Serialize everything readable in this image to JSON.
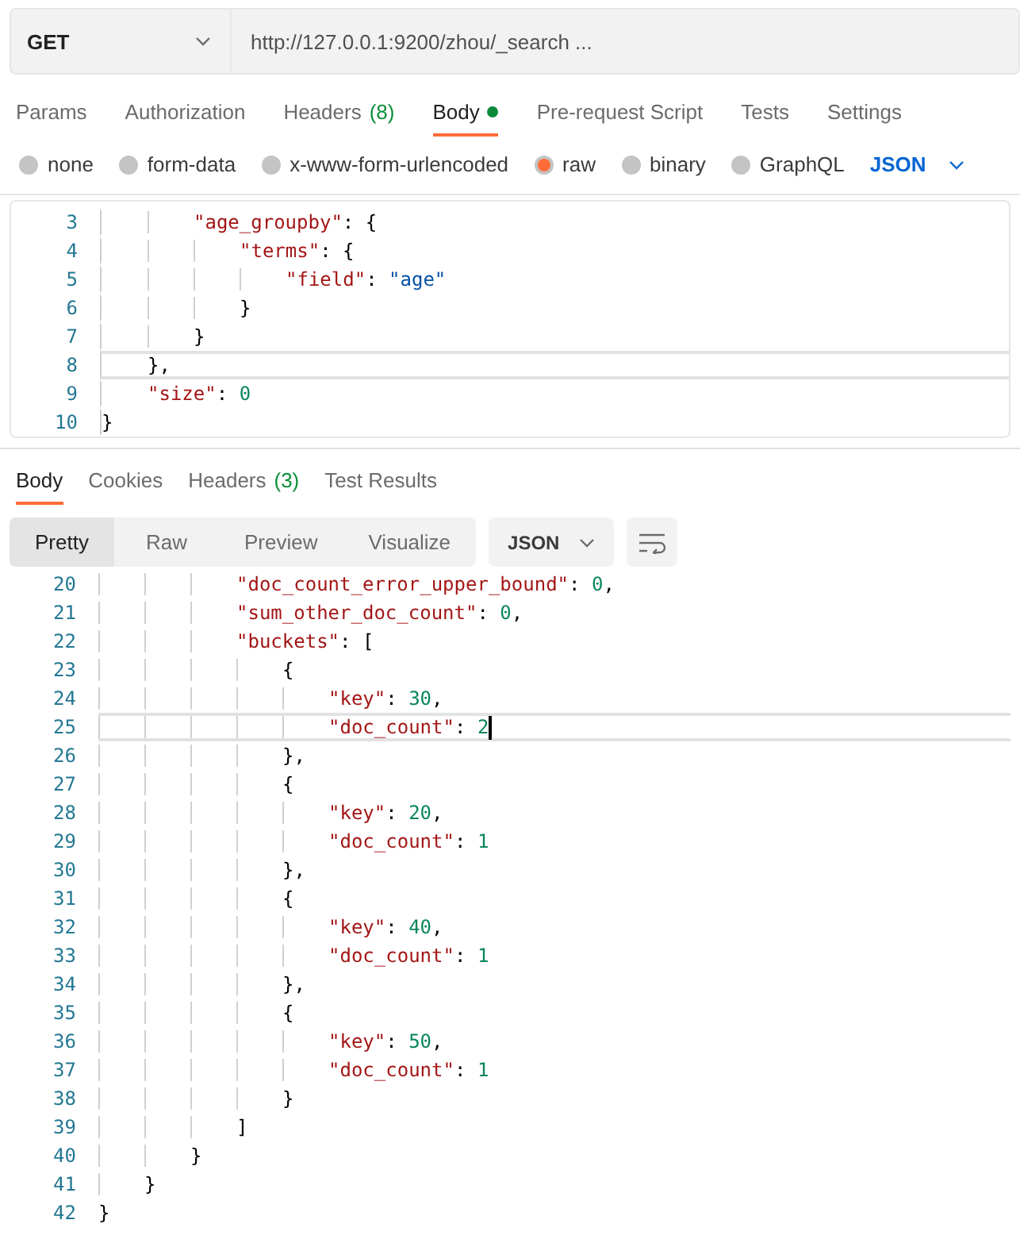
{
  "request": {
    "method": "GET",
    "url": "http://127.0.0.1:9200/zhou/_search ..."
  },
  "request_tabs": [
    {
      "label": "Params",
      "selected": false,
      "dot": false
    },
    {
      "label": "Authorization",
      "selected": false,
      "dot": false
    },
    {
      "label": "Headers",
      "count": "(8)",
      "selected": false,
      "dot": false
    },
    {
      "label": "Body",
      "dot": true,
      "selected": true
    },
    {
      "label": "Pre-request Script",
      "selected": false,
      "dot": false
    },
    {
      "label": "Tests",
      "selected": false,
      "dot": false
    },
    {
      "label": "Settings",
      "selected": false,
      "dot": false
    }
  ],
  "body_types": [
    {
      "label": "none",
      "selected": false
    },
    {
      "label": "form-data",
      "selected": false
    },
    {
      "label": "x-www-form-urlencoded",
      "selected": false
    },
    {
      "label": "raw",
      "selected": true
    },
    {
      "label": "binary",
      "selected": false
    },
    {
      "label": "GraphQL",
      "selected": false
    }
  ],
  "body_format": "JSON",
  "request_editor": [
    {
      "num": "3",
      "current": false,
      "tokens": [
        {
          "kind": "key",
          "text": "\t\t\"age_groupby\""
        },
        {
          "kind": "punct",
          "text": ": {"
        }
      ]
    },
    {
      "num": "4",
      "current": false,
      "tokens": [
        {
          "kind": "key",
          "text": "\t\t\t\"terms\""
        },
        {
          "kind": "punct",
          "text": ": {"
        }
      ]
    },
    {
      "num": "5",
      "current": false,
      "tokens": [
        {
          "kind": "key",
          "text": "\t\t\t\t\"field\""
        },
        {
          "kind": "punct",
          "text": ": "
        },
        {
          "kind": "str",
          "text": "\"age\""
        }
      ]
    },
    {
      "num": "6",
      "current": false,
      "tokens": [
        {
          "kind": "punct",
          "text": "\t\t\t}"
        }
      ]
    },
    {
      "num": "7",
      "current": false,
      "tokens": [
        {
          "kind": "punct",
          "text": "\t\t}"
        }
      ]
    },
    {
      "num": "8",
      "current": true,
      "tokens": [
        {
          "kind": "punct",
          "text": "\t},"
        }
      ]
    },
    {
      "num": "9",
      "current": false,
      "tokens": [
        {
          "kind": "key",
          "text": "\t\"size\""
        },
        {
          "kind": "punct",
          "text": ": "
        },
        {
          "kind": "num",
          "text": "0"
        }
      ]
    },
    {
      "num": "10",
      "current": false,
      "tokens": [
        {
          "kind": "punct",
          "text": "}"
        }
      ]
    }
  ],
  "response_tabs": [
    {
      "label": "Body",
      "selected": true
    },
    {
      "label": "Cookies",
      "selected": false
    },
    {
      "label": "Headers",
      "count": "(3)",
      "selected": false
    },
    {
      "label": "Test Results",
      "selected": false
    }
  ],
  "view_modes": [
    {
      "label": "Pretty",
      "selected": true
    },
    {
      "label": "Raw",
      "selected": false
    },
    {
      "label": "Preview",
      "selected": false
    },
    {
      "label": "Visualize",
      "selected": false
    }
  ],
  "response_format": "JSON",
  "response_editor": [
    {
      "num": "20",
      "current": false,
      "tokens": [
        {
          "kind": "key",
          "text": "\t\t\t\"doc_count_error_upper_bound\""
        },
        {
          "kind": "punct",
          "text": ": "
        },
        {
          "kind": "num",
          "text": "0"
        },
        {
          "kind": "punct",
          "text": ","
        }
      ]
    },
    {
      "num": "21",
      "current": false,
      "tokens": [
        {
          "kind": "key",
          "text": "\t\t\t\"sum_other_doc_count\""
        },
        {
          "kind": "punct",
          "text": ": "
        },
        {
          "kind": "num",
          "text": "0"
        },
        {
          "kind": "punct",
          "text": ","
        }
      ]
    },
    {
      "num": "22",
      "current": false,
      "tokens": [
        {
          "kind": "key",
          "text": "\t\t\t\"buckets\""
        },
        {
          "kind": "punct",
          "text": ": ["
        }
      ]
    },
    {
      "num": "23",
      "current": false,
      "tokens": [
        {
          "kind": "punct",
          "text": "\t\t\t\t{"
        }
      ]
    },
    {
      "num": "24",
      "current": false,
      "tokens": [
        {
          "kind": "key",
          "text": "\t\t\t\t\t\"key\""
        },
        {
          "kind": "punct",
          "text": ": "
        },
        {
          "kind": "num",
          "text": "30"
        },
        {
          "kind": "punct",
          "text": ","
        }
      ]
    },
    {
      "num": "25",
      "current": true,
      "tokens": [
        {
          "kind": "key",
          "text": "\t\t\t\t\t\"doc_count\""
        },
        {
          "kind": "punct",
          "text": ": "
        },
        {
          "kind": "num",
          "text": "2"
        }
      ]
    },
    {
      "num": "26",
      "current": false,
      "tokens": [
        {
          "kind": "punct",
          "text": "\t\t\t\t},"
        }
      ]
    },
    {
      "num": "27",
      "current": false,
      "tokens": [
        {
          "kind": "punct",
          "text": "\t\t\t\t{"
        }
      ]
    },
    {
      "num": "28",
      "current": false,
      "tokens": [
        {
          "kind": "key",
          "text": "\t\t\t\t\t\"key\""
        },
        {
          "kind": "punct",
          "text": ": "
        },
        {
          "kind": "num",
          "text": "20"
        },
        {
          "kind": "punct",
          "text": ","
        }
      ]
    },
    {
      "num": "29",
      "current": false,
      "tokens": [
        {
          "kind": "key",
          "text": "\t\t\t\t\t\"doc_count\""
        },
        {
          "kind": "punct",
          "text": ": "
        },
        {
          "kind": "num",
          "text": "1"
        }
      ]
    },
    {
      "num": "30",
      "current": false,
      "tokens": [
        {
          "kind": "punct",
          "text": "\t\t\t\t},"
        }
      ]
    },
    {
      "num": "31",
      "current": false,
      "tokens": [
        {
          "kind": "punct",
          "text": "\t\t\t\t{"
        }
      ]
    },
    {
      "num": "32",
      "current": false,
      "tokens": [
        {
          "kind": "key",
          "text": "\t\t\t\t\t\"key\""
        },
        {
          "kind": "punct",
          "text": ": "
        },
        {
          "kind": "num",
          "text": "40"
        },
        {
          "kind": "punct",
          "text": ","
        }
      ]
    },
    {
      "num": "33",
      "current": false,
      "tokens": [
        {
          "kind": "key",
          "text": "\t\t\t\t\t\"doc_count\""
        },
        {
          "kind": "punct",
          "text": ": "
        },
        {
          "kind": "num",
          "text": "1"
        }
      ]
    },
    {
      "num": "34",
      "current": false,
      "tokens": [
        {
          "kind": "punct",
          "text": "\t\t\t\t},"
        }
      ]
    },
    {
      "num": "35",
      "current": false,
      "tokens": [
        {
          "kind": "punct",
          "text": "\t\t\t\t{"
        }
      ]
    },
    {
      "num": "36",
      "current": false,
      "tokens": [
        {
          "kind": "key",
          "text": "\t\t\t\t\t\"key\""
        },
        {
          "kind": "punct",
          "text": ": "
        },
        {
          "kind": "num",
          "text": "50"
        },
        {
          "kind": "punct",
          "text": ","
        }
      ]
    },
    {
      "num": "37",
      "current": false,
      "tokens": [
        {
          "kind": "key",
          "text": "\t\t\t\t\t\"doc_count\""
        },
        {
          "kind": "punct",
          "text": ": "
        },
        {
          "kind": "num",
          "text": "1"
        }
      ]
    },
    {
      "num": "38",
      "current": false,
      "tokens": [
        {
          "kind": "punct",
          "text": "\t\t\t\t}"
        }
      ]
    },
    {
      "num": "39",
      "current": false,
      "tokens": [
        {
          "kind": "punct",
          "text": "\t\t\t]"
        }
      ]
    },
    {
      "num": "40",
      "current": false,
      "tokens": [
        {
          "kind": "punct",
          "text": "\t\t}"
        }
      ]
    },
    {
      "num": "41",
      "current": false,
      "tokens": [
        {
          "kind": "punct",
          "text": "\t}"
        }
      ]
    },
    {
      "num": "42",
      "current": false,
      "tokens": [
        {
          "kind": "punct",
          "text": "}"
        }
      ]
    }
  ]
}
